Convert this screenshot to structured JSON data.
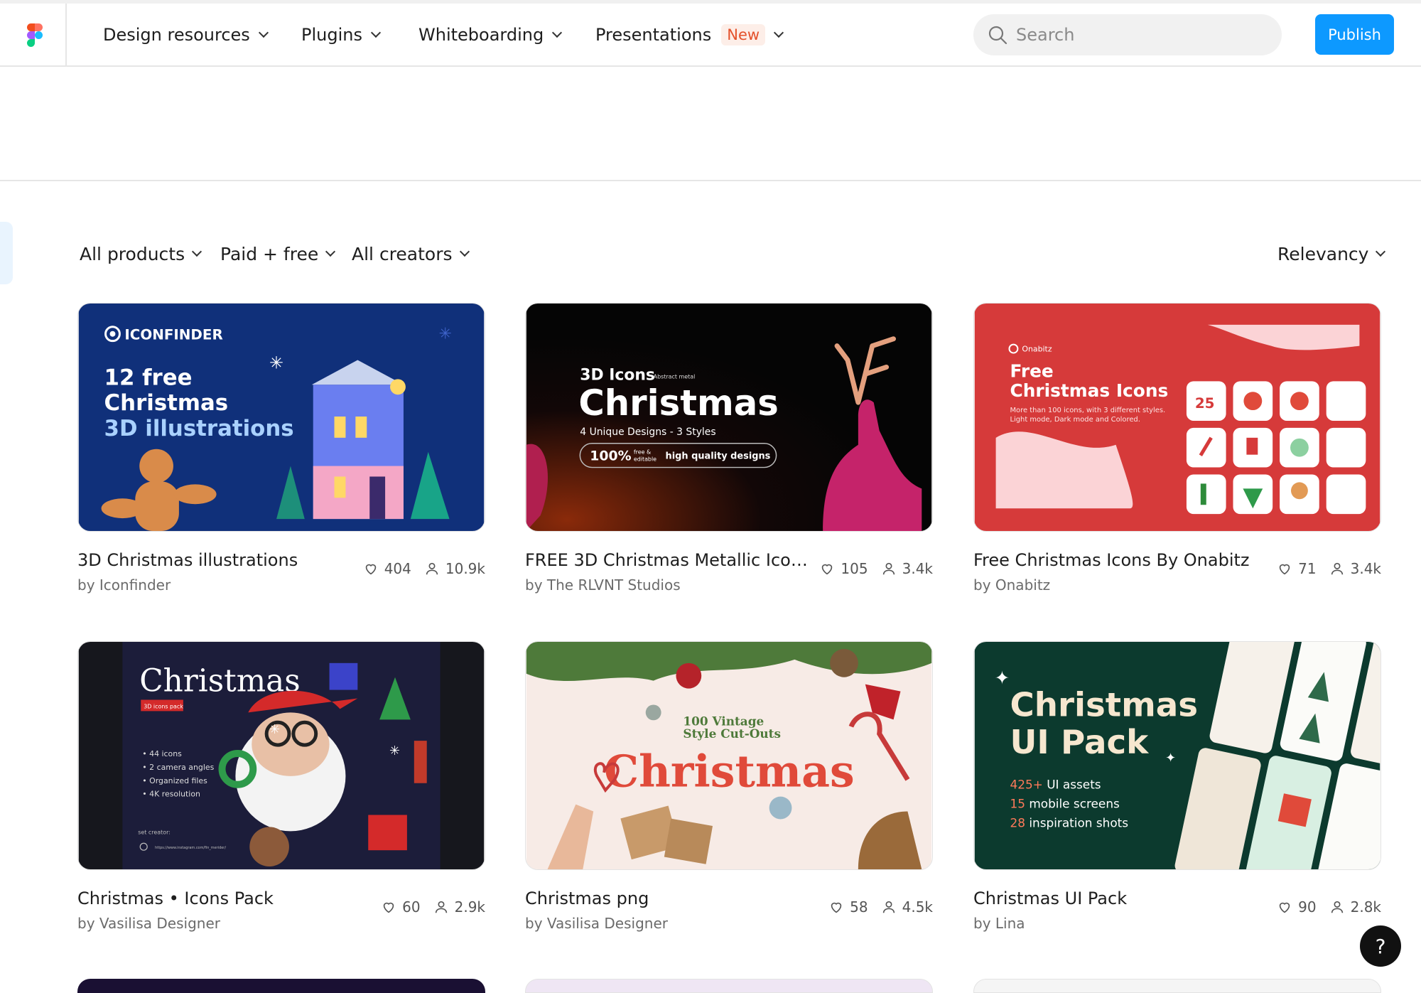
{
  "nav": {
    "items": [
      {
        "label": "Design resources"
      },
      {
        "label": "Plugins"
      },
      {
        "label": "Whiteboarding"
      },
      {
        "label": "Presentations",
        "badge": "New"
      }
    ],
    "search_placeholder": "Search",
    "publish_label": "Publish"
  },
  "filters": {
    "products": "All products",
    "pricing": "Paid + free",
    "creators": "All creators",
    "sort": "Relevancy"
  },
  "cards": [
    {
      "title": "3D Christmas illustrations",
      "author": "by Iconfinder",
      "likes": "404",
      "users": "10.9k",
      "thumb": {
        "brand": "ICONFINDER",
        "line1": "12 free",
        "line2": "Christmas",
        "line3": "3D illustrations"
      }
    },
    {
      "title": "FREE 3D Christmas Metallic Icon...",
      "author": "by The RLVNT Studios",
      "likes": "105",
      "users": "3.4k",
      "thumb": {
        "kicker": "3D Icons",
        "kicker_small": "Abstract metal",
        "headline": "Christmas",
        "sub": "4 Unique Designs - 3 Styles",
        "pill_big": "100%",
        "pill_small1": "free &",
        "pill_small2": "editable",
        "pill_text": "high quality designs"
      }
    },
    {
      "title": "Free Christmas Icons By Onabitz",
      "author": "by Onabitz",
      "likes": "71",
      "users": "3.4k",
      "thumb": {
        "brand": "Onabitz",
        "line1": "Free",
        "line2": "Christmas Icons",
        "desc1": "More than 100 icons, with 3 different styles.",
        "desc2": "Light mode, Dark mode and Colored.",
        "tile_number": "25"
      }
    },
    {
      "title": "Christmas • Icons Pack",
      "author": "by Vasilisa Designer",
      "likes": "60",
      "users": "2.9k",
      "thumb": {
        "headline": "Christmas",
        "tag": "3D icons pack",
        "b1": "44 icons",
        "b2": "2 camera angles",
        "b3": "Organized files",
        "b4": "4K resolution",
        "set_creator": "set creator:",
        "link": "https://www.instagram.com/fin_merider/"
      }
    },
    {
      "title": "Christmas png",
      "author": "by Vasilisa Designer",
      "likes": "58",
      "users": "4.5k",
      "thumb": {
        "line1": "100 Vintage",
        "line2": "Style Cut-Outs",
        "headline": "Christmas"
      }
    },
    {
      "title": "Christmas UI Pack",
      "author": "by Lina",
      "likes": "90",
      "users": "2.8k",
      "thumb": {
        "line1": "Christmas",
        "line2": "UI Pack",
        "s1n": "425+",
        "s1t": " UI assets",
        "s2n": "15",
        "s2t": " mobile screens",
        "s3n": "28",
        "s3t": " inspiration shots"
      }
    }
  ],
  "help_label": "?",
  "colors": {
    "publish": "#0d99ff",
    "badge": "#e4512b",
    "link_blue": "#0d99ff"
  }
}
